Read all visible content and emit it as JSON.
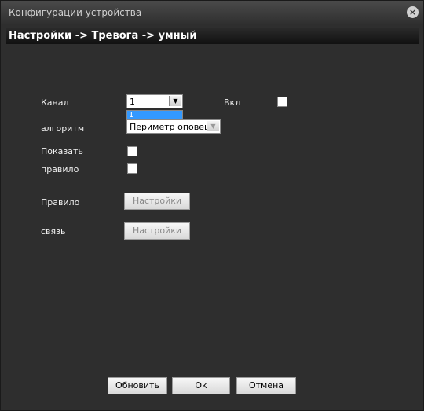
{
  "window": {
    "title": "Конфигурации устройства"
  },
  "breadcrumb": "Настройки -> Тревога -> умный",
  "form": {
    "channel_label": "Канал",
    "channel_value": "1",
    "dropdown_option": "1",
    "enable_label": "Вкл",
    "algorithm_label": "алгоритм",
    "algorithm_value": "Периметр оповеще",
    "show_label": "Показать",
    "rule_label": "правило"
  },
  "sections": {
    "rule_label": "Правило",
    "rule_button": "Настройки",
    "link_label": "связь",
    "link_button": "Настройки"
  },
  "footer": {
    "refresh": "Обновить",
    "ok": "Ок",
    "cancel": "Отмена"
  }
}
